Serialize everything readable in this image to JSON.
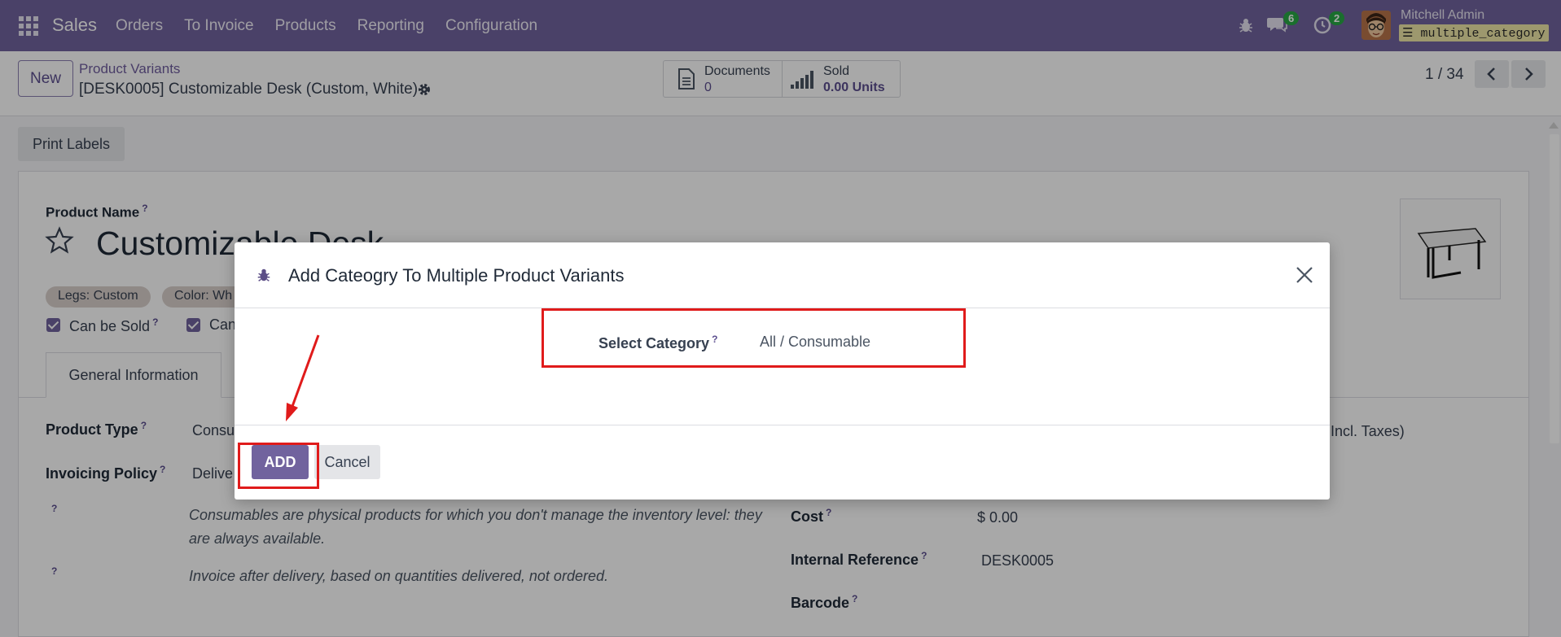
{
  "navbar": {
    "app_name": "Sales",
    "menu": [
      "Orders",
      "To Invoice",
      "Products",
      "Reporting",
      "Configuration"
    ],
    "chat_count": "6",
    "activity_count": "2",
    "user_name": "Mitchell Admin",
    "database": "multiple_category"
  },
  "control_panel": {
    "new_label": "New",
    "breadcrumb_parent": "Product Variants",
    "breadcrumb_current": "[DESK0005] Customizable Desk (Custom, White)",
    "documents_label": "Documents",
    "documents_value": "0",
    "sold_label": "Sold",
    "sold_value": "0.00 Units",
    "pager": "1 / 34"
  },
  "form": {
    "print_labels": "Print Labels",
    "product_name_label": "Product Name",
    "product_name": "Customizable Desk",
    "tags": [
      "Legs: Custom",
      "Color: Wh"
    ],
    "can_be_sold": "Can be Sold",
    "can_be_purchased_partial": "Can",
    "tab_general": "General Information",
    "product_type_label": "Product Type",
    "product_type_value": "Consu",
    "invoicing_policy_label": "Invoicing Policy",
    "invoicing_policy_value": "Delive",
    "help_consumable": "Consumables are physical products for which you don't manage the inventory level: they are always available.",
    "help_invoice": "Invoice after delivery, based on quantities delivered, not ordered.",
    "incl_taxes": "Incl. Taxes)",
    "cost_label": "Cost",
    "cost_value": "$ 0.00",
    "internal_ref_label": "Internal Reference",
    "internal_ref_value": "DESK0005",
    "barcode_label": "Barcode",
    "help_mark": "?"
  },
  "modal": {
    "title": "Add Cateogry To Multiple Product Variants",
    "category_label": "Select Category",
    "category_value": "All / Consumable",
    "add_label": "ADD",
    "cancel_label": "Cancel"
  },
  "colors": {
    "brand": "#71639e",
    "annotation": "#e01b1b",
    "badge": "#28a745"
  }
}
